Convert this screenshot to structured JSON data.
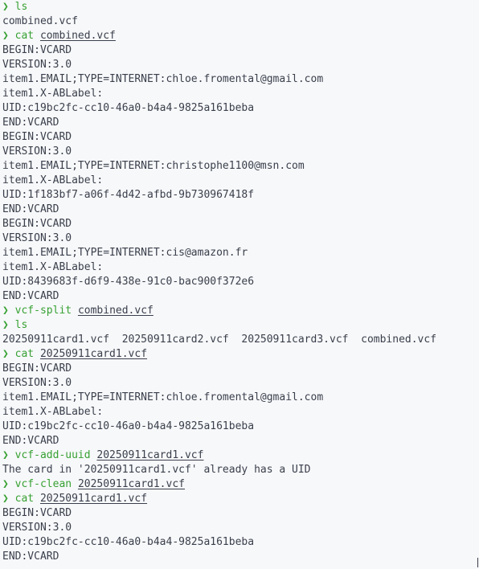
{
  "colors": {
    "background": "#f7f8fa",
    "text": "#3a3f4b",
    "prompt_accent": "#37a132"
  },
  "prompt_symbol": "❯",
  "lines": [
    {
      "type": "cmd",
      "command": "ls",
      "arg": ""
    },
    {
      "type": "out",
      "text": "combined.vcf"
    },
    {
      "type": "cmd",
      "command": "cat",
      "arg": "combined.vcf"
    },
    {
      "type": "out",
      "text": "BEGIN:VCARD"
    },
    {
      "type": "out",
      "text": "VERSION:3.0"
    },
    {
      "type": "out",
      "text": "item1.EMAIL;TYPE=INTERNET:chloe.fromental@gmail.com"
    },
    {
      "type": "out",
      "text": "item1.X-ABLabel:"
    },
    {
      "type": "out",
      "text": "UID:c19bc2fc-cc10-46a0-b4a4-9825a161beba"
    },
    {
      "type": "out",
      "text": "END:VCARD"
    },
    {
      "type": "out",
      "text": "BEGIN:VCARD"
    },
    {
      "type": "out",
      "text": "VERSION:3.0"
    },
    {
      "type": "out",
      "text": "item1.EMAIL;TYPE=INTERNET:christophe1100@msn.com"
    },
    {
      "type": "out",
      "text": "item1.X-ABLabel:"
    },
    {
      "type": "out",
      "text": "UID:1f183bf7-a06f-4d42-afbd-9b730967418f"
    },
    {
      "type": "out",
      "text": "END:VCARD"
    },
    {
      "type": "out",
      "text": "BEGIN:VCARD"
    },
    {
      "type": "out",
      "text": "VERSION:3.0"
    },
    {
      "type": "out",
      "text": "item1.EMAIL;TYPE=INTERNET:cis@amazon.fr"
    },
    {
      "type": "out",
      "text": "item1.X-ABLabel:"
    },
    {
      "type": "out",
      "text": "UID:8439683f-d6f9-438e-91c0-bac900f372e6"
    },
    {
      "type": "out",
      "text": "END:VCARD"
    },
    {
      "type": "cmd",
      "command": "vcf-split",
      "arg": "combined.vcf"
    },
    {
      "type": "cmd",
      "command": "ls",
      "arg": ""
    },
    {
      "type": "out",
      "text": "20250911card1.vcf  20250911card2.vcf  20250911card3.vcf  combined.vcf"
    },
    {
      "type": "cmd",
      "command": "cat",
      "arg": "20250911card1.vcf"
    },
    {
      "type": "out",
      "text": "BEGIN:VCARD"
    },
    {
      "type": "out",
      "text": "VERSION:3.0"
    },
    {
      "type": "out",
      "text": "item1.EMAIL;TYPE=INTERNET:chloe.fromental@gmail.com"
    },
    {
      "type": "out",
      "text": "item1.X-ABLabel:"
    },
    {
      "type": "out",
      "text": "UID:c19bc2fc-cc10-46a0-b4a4-9825a161beba"
    },
    {
      "type": "out",
      "text": "END:VCARD"
    },
    {
      "type": "cmd",
      "command": "vcf-add-uuid",
      "arg": "20250911card1.vcf"
    },
    {
      "type": "out",
      "text": "The card in '20250911card1.vcf' already has a UID"
    },
    {
      "type": "cmd",
      "command": "vcf-clean",
      "arg": "20250911card1.vcf"
    },
    {
      "type": "cmd",
      "command": "cat",
      "arg": "20250911card1.vcf"
    },
    {
      "type": "out",
      "text": "BEGIN:VCARD"
    },
    {
      "type": "out",
      "text": "VERSION:3.0"
    },
    {
      "type": "out",
      "text": "UID:c19bc2fc-cc10-46a0-b4a4-9825a161beba"
    },
    {
      "type": "out",
      "text": "END:VCARD"
    }
  ]
}
